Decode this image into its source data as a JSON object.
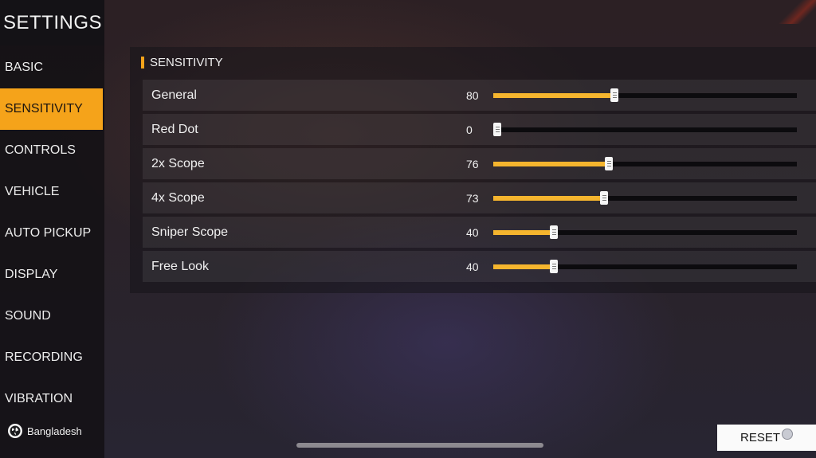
{
  "sidebar": {
    "title": "SETTINGS",
    "items": [
      {
        "label": "BASIC",
        "name": "sidebar-item-basic"
      },
      {
        "label": "SENSITIVITY",
        "name": "sidebar-item-sensitivity",
        "active": true
      },
      {
        "label": "CONTROLS",
        "name": "sidebar-item-controls"
      },
      {
        "label": "VEHICLE",
        "name": "sidebar-item-vehicle"
      },
      {
        "label": "AUTO PICKUP",
        "name": "sidebar-item-auto-pickup"
      },
      {
        "label": "DISPLAY",
        "name": "sidebar-item-display"
      },
      {
        "label": "SOUND",
        "name": "sidebar-item-sound"
      },
      {
        "label": "RECORDING",
        "name": "sidebar-item-recording"
      },
      {
        "label": "VIBRATION",
        "name": "sidebar-item-vibration"
      }
    ],
    "region": {
      "label": "Bangladesh",
      "icon": "globe-icon"
    }
  },
  "panel": {
    "title": "SENSITIVITY",
    "slider_max": 100,
    "rows": [
      {
        "label": "General",
        "value": 80,
        "name": "general"
      },
      {
        "label": "Red Dot",
        "value": 0,
        "name": "red-dot"
      },
      {
        "label": "2x Scope",
        "value": 76,
        "name": "2x-scope"
      },
      {
        "label": "4x Scope",
        "value": 73,
        "name": "4x-scope"
      },
      {
        "label": "Sniper Scope",
        "value": 40,
        "name": "sniper-scope"
      },
      {
        "label": "Free Look",
        "value": 40,
        "name": "free-look"
      }
    ]
  },
  "footer": {
    "reset_label": "RESET",
    "reset_icon": "reset-badge-icon"
  },
  "colors": {
    "accent": "#f5a31a",
    "slider_fill": "#f5b52e",
    "slider_track": "#0c0b0e"
  }
}
